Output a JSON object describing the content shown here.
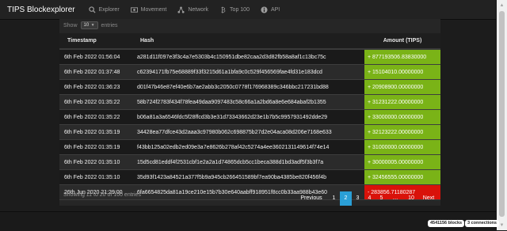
{
  "nav": {
    "brand": "TIPS Blockexplorer",
    "items": [
      {
        "label": "Explorer",
        "icon": "search-icon"
      },
      {
        "label": "Movement",
        "icon": "money-icon"
      },
      {
        "label": "Network",
        "icon": "network-icon"
      },
      {
        "label": "Top 100",
        "icon": "bitcoin-icon"
      },
      {
        "label": "API",
        "icon": "info-icon"
      }
    ]
  },
  "table": {
    "show_label": "Show",
    "page_length": "10",
    "entries_label": "entries",
    "headers": {
      "timestamp": "Timestamp",
      "hash": "Hash",
      "amount": "Amount (TIPS)"
    },
    "rows": [
      {
        "timestamp": "6th Feb 2022 01:56:04",
        "hash": "a281d11f097e3f3c4a7e5303b4c150951dbe82caa2d3d82fb58a8af1c13bc75c",
        "amount": "+ 877193506.83830000",
        "type": "pos"
      },
      {
        "timestamp": "6th Feb 2022 01:37:48",
        "hash": "c62394171fb75e68889f33f3215d61a1bfa9c0c529f456569fae4fd31e183dcd",
        "amount": "+ 15104010.00000000",
        "type": "pos"
      },
      {
        "timestamp": "6th Feb 2022 01:36:23",
        "hash": "d01f47b46e87ef40e6b7ae2abb3c2050c0778f176968389c346bbc217231bd88",
        "amount": "+ 20908900.00000000",
        "type": "pos"
      },
      {
        "timestamp": "6th Feb 2022 01:35:22",
        "hash": "58b724f2783f434f78fea49daa9097483c58c66a1a2bd6a8e6e684abaf2b1355",
        "amount": "+ 31231222.00000000",
        "type": "pos"
      },
      {
        "timestamp": "6th Feb 2022 01:35:22",
        "hash": "b06a81a3a6546fdc5f28ffcd3b3e31d73343662d23e1b7b5c9957931492dde29",
        "amount": "+ 33000000.00000000",
        "type": "pos"
      },
      {
        "timestamp": "6th Feb 2022 01:35:19",
        "hash": "34428ea77dfce43d2aaa3c97980b062c698875b27d2e04aca08d206e7168e633",
        "amount": "+ 32123222.00000000",
        "type": "pos"
      },
      {
        "timestamp": "6th Feb 2022 01:35:19",
        "hash": "f43bb125a02edb2ed09e3a7e8626b278af42c5274a4ee3602131149614f74e14",
        "amount": "+ 31000000.00000000",
        "type": "pos"
      },
      {
        "timestamp": "6th Feb 2022 01:35:10",
        "hash": "15d5cd81eddf4f2531cbf1e2a2a1d74865dcb5cc1beca388d1bd3adf5f3b3f7a",
        "amount": "+ 30000005.00000000",
        "type": "pos"
      },
      {
        "timestamp": "6th Feb 2022 01:35:10",
        "hash": "35d93f1423a84521a377f5b9a945cb266451589bf7ea90ba4385be820f456f4b",
        "amount": "+ 32456555.00000000",
        "type": "pos"
      },
      {
        "timestamp": "26th Jun 2020 21:29:00",
        "hash": "6fa6654825da81a19ce210e15b7b30e640aabff918951f8cc0b33aa988b43e60",
        "amount": "- 283856.71180287",
        "type": "neg"
      }
    ],
    "info": "Showing 11 to 20 of 100 entries",
    "pagination": [
      "Previous",
      "1",
      "2",
      "3",
      "4",
      "5",
      "…",
      "10",
      "Next"
    ]
  },
  "footer": {
    "blocks": "4541156 blocks",
    "connections": "3 connections"
  },
  "colors": {
    "positive": "#7ab317",
    "negative": "#d9120a",
    "active_page": "#2a9fd6"
  }
}
